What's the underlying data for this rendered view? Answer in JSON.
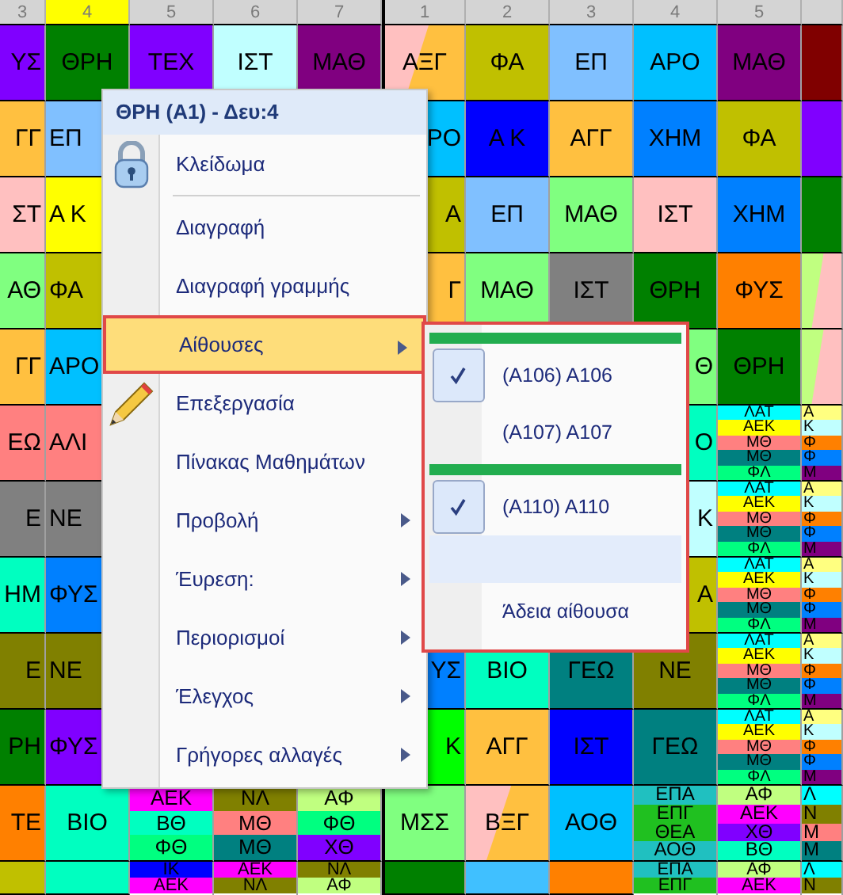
{
  "grid": {
    "header": [
      {
        "label": "3",
        "selected": false
      },
      {
        "label": "4",
        "selected": true
      },
      {
        "label": "5",
        "selected": false
      },
      {
        "label": "6",
        "selected": false
      },
      {
        "label": "7",
        "selected": false
      },
      {
        "label": "1",
        "selected": false
      },
      {
        "label": "2",
        "selected": false
      },
      {
        "label": "3",
        "selected": false
      },
      {
        "label": "4",
        "selected": false
      },
      {
        "label": "5",
        "selected": false
      }
    ],
    "rows": [
      [
        {
          "kind": "plain",
          "text": "ΥΣ",
          "color": "#8000ff"
        },
        {
          "kind": "plain",
          "text": "ΘΡΗ",
          "color": "#008000"
        },
        {
          "kind": "plain",
          "text": "ΤΕΧ",
          "color": "#8000ff"
        },
        {
          "kind": "plain",
          "text": "ΙΣΤ",
          "color": "#c0ffff"
        },
        {
          "kind": "plain",
          "text": "ΜΑΘ",
          "color": "#800080"
        },
        {
          "kind": "diagonal",
          "text": "ΑΞΓ",
          "shades": [
            {
              "color": "#ffc0c0"
            },
            {
              "color": "#ffc040"
            }
          ]
        },
        {
          "kind": "plain",
          "text": "ΦΑ",
          "color": "#c0c000"
        },
        {
          "kind": "plain",
          "text": "ΕΠ",
          "color": "#80c0ff"
        },
        {
          "kind": "plain",
          "text": "ΑΡΟ",
          "color": "#00c0ff"
        },
        {
          "kind": "plain",
          "text": "ΜΑΘ",
          "color": "#800080"
        },
        {
          "kind": "plain",
          "color": "#800000"
        }
      ],
      [
        {
          "kind": "plain",
          "text": "ΓΓ",
          "color": "#ffc040"
        },
        {
          "kind": "plain",
          "text": "ΕΠ",
          "color": "#80c0ff"
        },
        null,
        null,
        null,
        {
          "kind": "plain",
          "text": "ΡΟ",
          "color": "#00c0ff"
        },
        {
          "kind": "plain",
          "text": "Α Κ",
          "color": "#0000ff"
        },
        {
          "kind": "plain",
          "text": "ΑΓΓ",
          "color": "#ffc040"
        },
        {
          "kind": "plain",
          "text": "ΧΗΜ",
          "color": "#0080ff"
        },
        {
          "kind": "plain",
          "text": "ΦΑ",
          "color": "#c0c000"
        },
        {
          "kind": "plain",
          "color": "#8000ff"
        }
      ],
      [
        {
          "kind": "plain",
          "text": "ΣΤ",
          "color": "#ffc0c0"
        },
        {
          "kind": "plain",
          "text": "Α Κ",
          "color": "#ffff00"
        },
        null,
        null,
        null,
        {
          "kind": "plain",
          "text": "Α",
          "color": "#c0c000"
        },
        {
          "kind": "plain",
          "text": "ΕΠ",
          "color": "#80c0ff"
        },
        {
          "kind": "plain",
          "text": "ΜΑΘ",
          "color": "#80ff80"
        },
        {
          "kind": "plain",
          "text": "ΙΣΤ",
          "color": "#ffc0c0"
        },
        {
          "kind": "plain",
          "text": "ΧΗΜ",
          "color": "#0080ff"
        },
        {
          "kind": "plain",
          "color": "#008000"
        }
      ],
      [
        {
          "kind": "plain",
          "text": "ΑΘ",
          "color": "#80ff80"
        },
        {
          "kind": "plain",
          "text": "ΦΑ",
          "color": "#c0c000"
        },
        null,
        null,
        null,
        {
          "kind": "plain",
          "text": "Γ",
          "color": "#ffc040"
        },
        {
          "kind": "plain",
          "text": "ΜΑΘ",
          "color": "#80ff80"
        },
        {
          "kind": "plain",
          "text": "ΙΣΤ",
          "color": "#808080"
        },
        {
          "kind": "plain",
          "text": "ΘΡΗ",
          "color": "#008000"
        },
        {
          "kind": "plain",
          "text": "ΦΥΣ",
          "color": "#ff8000"
        },
        {
          "kind": "diagonal",
          "shades": [
            {
              "color": "#c0ff80"
            },
            {
              "color": "#ffc0c0"
            }
          ]
        }
      ],
      [
        {
          "kind": "plain",
          "text": "ΓΓ",
          "color": "#ffc040"
        },
        {
          "kind": "plain",
          "text": "ΑΡΟ",
          "color": "#00c0ff"
        },
        null,
        null,
        null,
        null,
        null,
        null,
        {
          "kind": "plain",
          "text": "Θ",
          "color": "#80ff80"
        },
        {
          "kind": "plain",
          "text": "ΘΡΗ",
          "color": "#008000"
        },
        {
          "kind": "diagonal",
          "shades": [
            {
              "color": "#c0ff80"
            },
            {
              "color": "#ffc0c0"
            }
          ]
        }
      ],
      [
        {
          "kind": "plain",
          "text": "ΕΩ",
          "color": "#ff8080"
        },
        {
          "kind": "plain",
          "text": "ΑΛΙ",
          "color": "#ff8080"
        },
        null,
        null,
        null,
        null,
        null,
        null,
        {
          "kind": "plain",
          "text": "Ο",
          "color": "#00ffc0"
        },
        {
          "kind": "split",
          "parts": [
            {
              "text": "ΛΑΤ",
              "color": "#00ffff"
            },
            {
              "text": "ΑΕΚ",
              "color": "#ffff00"
            },
            {
              "text": "ΜΘ",
              "color": "#ff8080"
            },
            {
              "text": "ΜΘ",
              "color": "#008080"
            },
            {
              "text": "ΦΛ",
              "color": "#00ff80"
            }
          ]
        },
        {
          "kind": "split",
          "parts": [
            {
              "text": "Α",
              "color": "#ffff80"
            },
            {
              "text": "Κ",
              "color": "#c0ffff"
            },
            {
              "text": "Φ",
              "color": "#ff8000"
            },
            {
              "text": "Φ",
              "color": "#0080ff"
            },
            {
              "text": "Μ",
              "color": "#800080"
            }
          ]
        }
      ],
      [
        {
          "kind": "plain",
          "text": "Ε",
          "color": "#808080"
        },
        {
          "kind": "plain",
          "text": "ΝΕ",
          "color": "#808080"
        },
        null,
        null,
        null,
        null,
        null,
        null,
        {
          "kind": "plain",
          "text": "Κ",
          "color": "#c0ffff"
        },
        {
          "kind": "split",
          "parts": [
            {
              "text": "ΛΑΤ",
              "color": "#00ffff"
            },
            {
              "text": "ΑΕΚ",
              "color": "#ffff00"
            },
            {
              "text": "ΜΘ",
              "color": "#ff8080"
            },
            {
              "text": "ΜΘ",
              "color": "#008080"
            },
            {
              "text": "ΦΛ",
              "color": "#00ff80"
            }
          ]
        },
        {
          "kind": "split",
          "parts": [
            {
              "text": "Α",
              "color": "#ffff80"
            },
            {
              "text": "Κ",
              "color": "#c0ffff"
            },
            {
              "text": "Φ",
              "color": "#ff8000"
            },
            {
              "text": "Φ",
              "color": "#0080ff"
            },
            {
              "text": "Μ",
              "color": "#800080"
            }
          ]
        }
      ],
      [
        {
          "kind": "plain",
          "text": "ΗΜ",
          "color": "#00ffc0"
        },
        {
          "kind": "plain",
          "text": "ΦΥΣ",
          "color": "#0080ff"
        },
        null,
        null,
        null,
        null,
        null,
        null,
        {
          "kind": "plain",
          "text": "Α",
          "color": "#c0c000"
        },
        {
          "kind": "split",
          "parts": [
            {
              "text": "ΛΑΤ",
              "color": "#00ffff"
            },
            {
              "text": "ΑΕΚ",
              "color": "#ffff00"
            },
            {
              "text": "ΜΘ",
              "color": "#ff8080"
            },
            {
              "text": "ΜΘ",
              "color": "#008080"
            },
            {
              "text": "ΦΛ",
              "color": "#00ff80"
            }
          ]
        },
        {
          "kind": "split",
          "parts": [
            {
              "text": "Α",
              "color": "#ffff80"
            },
            {
              "text": "Κ",
              "color": "#c0ffff"
            },
            {
              "text": "Φ",
              "color": "#ff8000"
            },
            {
              "text": "Φ",
              "color": "#0080ff"
            },
            {
              "text": "Μ",
              "color": "#800080"
            }
          ]
        }
      ],
      [
        {
          "kind": "plain",
          "text": "Ε",
          "color": "#808000"
        },
        {
          "kind": "plain",
          "text": "ΝΕ",
          "color": "#808000"
        },
        null,
        null,
        null,
        {
          "kind": "plain",
          "text": "ΥΣ",
          "color": "#0080ff"
        },
        {
          "kind": "plain",
          "text": "ΒΙΟ",
          "color": "#00ffc0"
        },
        {
          "kind": "plain",
          "text": "ΓΕΩ",
          "color": "#008080"
        },
        {
          "kind": "plain",
          "text": "ΝΕ",
          "color": "#808000"
        },
        {
          "kind": "split",
          "parts": [
            {
              "text": "ΛΑΤ",
              "color": "#00ffff"
            },
            {
              "text": "ΑΕΚ",
              "color": "#ffff00"
            },
            {
              "text": "ΜΘ",
              "color": "#ff8080"
            },
            {
              "text": "ΜΘ",
              "color": "#008080"
            },
            {
              "text": "ΦΛ",
              "color": "#00ff80"
            }
          ]
        },
        {
          "kind": "split",
          "parts": [
            {
              "text": "Α",
              "color": "#ffff80"
            },
            {
              "text": "Κ",
              "color": "#c0ffff"
            },
            {
              "text": "Φ",
              "color": "#ff8000"
            },
            {
              "text": "Φ",
              "color": "#0080ff"
            },
            {
              "text": "Μ",
              "color": "#800080"
            }
          ]
        }
      ],
      [
        {
          "kind": "plain",
          "text": "ΡΗ",
          "color": "#008000"
        },
        {
          "kind": "plain",
          "text": "ΦΥΣ",
          "color": "#8000ff"
        },
        null,
        null,
        null,
        {
          "kind": "plain",
          "text": "Κ",
          "color": "#00ff00"
        },
        {
          "kind": "plain",
          "text": "ΑΓΓ",
          "color": "#ffc040"
        },
        {
          "kind": "plain",
          "text": "ΙΣΤ",
          "color": "#0000ff"
        },
        {
          "kind": "plain",
          "text": "ΓΕΩ",
          "color": "#008080"
        },
        {
          "kind": "split",
          "parts": [
            {
              "text": "ΛΑΤ",
              "color": "#00ffff"
            },
            {
              "text": "ΑΕΚ",
              "color": "#ffff00"
            },
            {
              "text": "ΜΘ",
              "color": "#ff8080"
            },
            {
              "text": "ΜΘ",
              "color": "#008080"
            },
            {
              "text": "ΦΛ",
              "color": "#00ff80"
            }
          ]
        },
        {
          "kind": "split",
          "parts": [
            {
              "text": "Α",
              "color": "#ffff80"
            },
            {
              "text": "Κ",
              "color": "#c0ffff"
            },
            {
              "text": "Φ",
              "color": "#ff8000"
            },
            {
              "text": "Φ",
              "color": "#0080ff"
            },
            {
              "text": "Μ",
              "color": "#800080"
            }
          ]
        }
      ],
      [
        {
          "kind": "plain",
          "text": "ΤΕ",
          "color": "#ff8000"
        },
        {
          "kind": "plain",
          "text": "ΒΙΟ",
          "color": "#00ffc0"
        },
        {
          "kind": "split",
          "parts": [
            {
              "text": "ΑΕΚ",
              "color": "#ff00ff"
            },
            {
              "text": "ΒΘ",
              "color": "#00ffc0"
            },
            {
              "text": "ΦΘ",
              "color": "#00ff80"
            }
          ]
        },
        {
          "kind": "split",
          "parts": [
            {
              "text": "ΝΛ",
              "color": "#808000"
            },
            {
              "text": "ΜΘ",
              "color": "#ff8080"
            },
            {
              "text": "ΜΘ",
              "color": "#008080"
            }
          ]
        },
        {
          "kind": "split",
          "parts": [
            {
              "text": "ΑΦ",
              "color": "#c0ff80"
            },
            {
              "text": "ΦΘ",
              "color": "#00ff80"
            },
            {
              "text": "ΧΘ",
              "color": "#8000ff"
            }
          ]
        },
        {
          "kind": "plain",
          "text": "ΜΣΣ",
          "color": "#80ff80"
        },
        {
          "kind": "diagonal",
          "text": "ΒΞΓ",
          "shades": [
            {
              "color": "#ffc0c0"
            },
            {
              "color": "#ffc040"
            }
          ]
        },
        {
          "kind": "plain",
          "text": "ΑΟΘ",
          "color": "#00c0ff"
        },
        {
          "kind": "split",
          "parts": [
            {
              "text": "ΕΠΑ",
              "color": "#20c0c0"
            },
            {
              "text": "ΕΠΓ",
              "color": "#20c020"
            },
            {
              "text": "ΘΕΑ",
              "color": "#20c020"
            },
            {
              "text": "ΑΟΘ",
              "color": "#20c0c0"
            }
          ]
        },
        {
          "kind": "split",
          "parts": [
            {
              "text": "ΑΦ",
              "color": "#c0ff80"
            },
            {
              "text": "ΑΕΚ",
              "color": "#ff00ff"
            },
            {
              "text": "ΧΘ",
              "color": "#8000ff"
            },
            {
              "text": "ΒΘ",
              "color": "#00ffc0"
            }
          ]
        },
        {
          "kind": "split",
          "parts": [
            {
              "text": "Λ",
              "color": "#00ffff"
            },
            {
              "text": "Ν",
              "color": "#808000"
            },
            {
              "text": "Μ",
              "color": "#ff8080"
            },
            {
              "text": "Μ",
              "color": "#008080"
            }
          ]
        }
      ],
      [
        {
          "kind": "plain",
          "color": "#c0c000"
        },
        {
          "kind": "plain",
          "color": "#00ffc0"
        },
        {
          "kind": "split",
          "parts": [
            {
              "text": "ΙΚ",
              "color": "#0000ff"
            },
            {
              "text": "ΑΕΚ",
              "color": "#ff00ff"
            }
          ]
        },
        {
          "kind": "split",
          "parts": [
            {
              "text": "ΑΕΚ",
              "color": "#ff00ff"
            },
            {
              "text": "ΝΛ",
              "color": "#808000"
            }
          ]
        },
        {
          "kind": "split",
          "parts": [
            {
              "text": "ΝΛ",
              "color": "#808000"
            },
            {
              "text": "ΑΦ",
              "color": "#c0ff80"
            }
          ]
        },
        {
          "kind": "plain",
          "color": "#008000"
        },
        {
          "kind": "plain",
          "color": "#40c0ff"
        },
        {
          "kind": "plain",
          "color": "#ff8000"
        },
        {
          "kind": "split",
          "parts": [
            {
              "text": "ΕΠΑ",
              "color": "#20c0c0"
            },
            {
              "text": "ΕΠΓ",
              "color": "#20c020"
            }
          ]
        },
        {
          "kind": "split",
          "parts": [
            {
              "text": "ΑΦ",
              "color": "#c0ff80"
            },
            {
              "text": "ΑΕΚ",
              "color": "#ff00ff"
            }
          ]
        },
        {
          "kind": "split",
          "parts": [
            {
              "text": "Λ",
              "color": "#00ffff"
            },
            {
              "text": "Ν",
              "color": "#808000"
            }
          ]
        }
      ]
    ]
  },
  "menu": {
    "title": "ΘΡΗ (Α1) - Δευ:4",
    "items": [
      {
        "kind": "lock",
        "label": "Κλείδωμα",
        "submenu": false,
        "selected": false
      },
      {
        "kind": "separator"
      },
      {
        "kind": "plain",
        "label": "Διαγραφή",
        "submenu": false,
        "selected": false
      },
      {
        "kind": "plain",
        "label": "Διαγραφή γραμμής",
        "submenu": false,
        "selected": false
      },
      {
        "kind": "plain",
        "label": "Αίθουσες",
        "submenu": true,
        "selected": true
      },
      {
        "kind": "edit",
        "label": "Επεξεργασία",
        "submenu": false,
        "selected": false
      },
      {
        "kind": "plain",
        "label": "Πίνακας Μαθημάτων",
        "submenu": false,
        "selected": false
      },
      {
        "kind": "plain",
        "label": "Προβολή",
        "submenu": true,
        "selected": false
      },
      {
        "kind": "plain",
        "label": "Έυρεση:",
        "submenu": true,
        "selected": false
      },
      {
        "kind": "plain",
        "label": "Περιορισμοί",
        "submenu": true,
        "selected": false
      },
      {
        "kind": "plain",
        "label": "Έλεγχος",
        "submenu": true,
        "selected": false
      },
      {
        "kind": "plain",
        "label": "Γρήγορες αλλαγές",
        "submenu": true,
        "selected": false
      }
    ]
  },
  "submenu": {
    "items": [
      {
        "kind": "bar"
      },
      {
        "kind": "room",
        "label": "(Α106) Α106",
        "checked": true,
        "selected": false
      },
      {
        "kind": "room",
        "label": "(Α107) Α107",
        "checked": false,
        "selected": false
      },
      {
        "kind": "bar"
      },
      {
        "kind": "room",
        "label": "(Α110) Α110",
        "checked": true,
        "selected": false
      },
      {
        "kind": "room",
        "checked": false,
        "selected": true
      },
      {
        "kind": "room",
        "label": "Άδεια αίθουσα",
        "checked": false,
        "selected": false
      }
    ]
  }
}
